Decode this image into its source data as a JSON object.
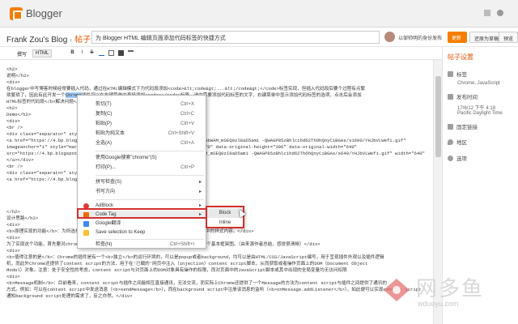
{
  "app": {
    "brand": "Blogger"
  },
  "header": {
    "blog_name": "Frank Zou's Blog",
    "separator": " · ",
    "post_label": "帖子",
    "post_title": "为 Blogger HTML 编辑页面添加代码标签的快捷方式",
    "author": "以邹帅明的身份发布",
    "publish_label": "更新",
    "draft_label": "还原为草稿",
    "preview_label": "预览"
  },
  "toolbar": {
    "compose_label": "撰写",
    "html_label": "HTML",
    "bold_icon": "B",
    "italic_icon": "I",
    "strike_icon": "S"
  },
  "editor": {
    "lines": [
      "<h2>",
      "说明</h2>",
      "<div>",
      "在blogger中写博客时候经常要插入代码，通过在HTML编辑模式下为代码段添加<code>&lt;code&gt;...&lt;/code&gt;</code>标签实现，但插入代码段后要个过程有点繁",
      "琐繁琐了，因此有此开发一个Chrome插件可以在右键菜单中直接添加<code></code>标签，选中需要添加代码标签的文字，右键菜单中显示添加代码标签的选项，点击后会添加",
      "HTML标签的代码段</b>解决问题</div>",
      "<h2>",
      "Demo</h2>",
      "<div>",
      "<br />",
      "<div class=\"separator\" style=\"clear: both; text-align: center;\">",
      "<a href=\"https://4.bp.blogspot.com/-7oHQ9xCzy3g/V_J84lvIvVI/AAAAAAAADaI/QubWAM_mSEQ0zI8aD5am1 -QWAGP85zBhlcihd62ThOhQnyCiBGAs/s1600/YHJbVLWefi.gif\"",
      "imageanchor=\"1\" style=\"margin-left: 1em; margin-right: 1em;\"><img border=\"0\" data-original-height=\"396\" data-original-width=\"640\"",
      "src=\"https://4.bp.blogspot.com/-7oHQ9xCzy3g/V_J84lvIvVI/AAAAAAAADaI/QubWAM_mSEQ0zI8aD5am1 -QWAGP85zBhlcihd62ThOhQnyCiBGAs/s640/YHJbVLWefi.gif\" width=\"640\" />",
      "</a></div>",
      "<br /> ",
      "<div class=\"separator\" style=\"clear: both;\">",
      "<a href=\"https://4.bp.blogspot.com/...\"",
      "",
      "",
      "",
      "",
      "</h2>",
      "设计思路</h2>",
      "<div>",
      "<b>原理实现的功能</b>：为所选择的文字添加代码标签,由于Blogger的文章编辑器直接解析代码中的样式内容。</div>",
      "<div>",
      "为了实现这个功能，首先要对chrome插件的架构有一定的了解。下面给出了Chrome插件的插件的一个基本框架图。（由来源作者总结，感觉很清晰）</div>",
      "<div>",
      "<b>值得注意的是</b>：Chrome的插件是有一个<b>独立</b>的运行环境的，可以是popup或者background，均可以是由HTML/CSS/JavaScript编写，用于呈现插件外观以及插件逻辑",
      "机，而此外Chrome还提供了content script的方法，用于在'已载的'网页中注入（injection）content script脚本，从而获取或者操作页面上的DOM（Document Object",
      "Model）对象。注意：处于安全性的考虑，content script与对页面上的DOM对象具有操作的权限，而对页面中的JavaScript脚本或其中出现的全局变量均无访问权限",
      "<div>",
      "<b>Message机制</b>：目前看来，content script与插件之间能相互直接通讯，无法交流，而实际上Chrome还提供了一个Message的方法为content script与插件之间提供了通讯的",
      "方式。例如：可以在content script中发送消息（<b>sendMessage</b>），而在background script中注册该消息的监听（<b>onMessage.addListener</b>），如此便可以实现content script",
      "通知background script处理的需求了，反之亦然。</div>"
    ]
  },
  "sidebar": {
    "title": "帖子设置",
    "labels_label": "标签",
    "labels_value": "Chrome, JavaScript",
    "published_label": "发布时间",
    "published_value_line1": "17/6/12 下午 4:18",
    "published_value_line2": "Pacific Daylight Time",
    "permalink_label": "固定链接",
    "location_label": "地区",
    "options_label": "选项"
  },
  "context_menu": {
    "items": [
      {
        "label": "剪切(T)",
        "shortcut": "Ctrl+X"
      },
      {
        "label": "复制(C)",
        "shortcut": "Ctrl+C"
      },
      {
        "label": "粘贴(P)",
        "shortcut": "Ctrl+V"
      },
      {
        "label": "粘贴为纯文本",
        "shortcut": "Ctrl+Shift+V"
      },
      {
        "label": "全选(A)",
        "shortcut": "Ctrl+A"
      },
      {
        "label": "使用Google搜索\"chrome\"(S)",
        "shortcut": ""
      },
      {
        "label": "打印(P)...",
        "shortcut": "Ctrl+P"
      },
      {
        "label": "拼写检查(S)",
        "shortcut": ""
      },
      {
        "label": "书写方向",
        "shortcut": ""
      },
      {
        "label": "AdBlock",
        "shortcut": ""
      },
      {
        "label": "Code Tag",
        "shortcut": ""
      },
      {
        "label": "Google翻译",
        "shortcut": ""
      },
      {
        "label": "Save selection to Keep",
        "shortcut": ""
      },
      {
        "label": "检查(N)",
        "shortcut": "Ctrl+Shift+I"
      }
    ]
  },
  "submenu": {
    "block_label": "Block",
    "inline_label": "Inline"
  },
  "watermark": {
    "text": "网多鱼",
    "url": "wduoyu.com"
  },
  "colors": {
    "accent": "#f57d00",
    "highlight_box": "#d32f2f"
  }
}
